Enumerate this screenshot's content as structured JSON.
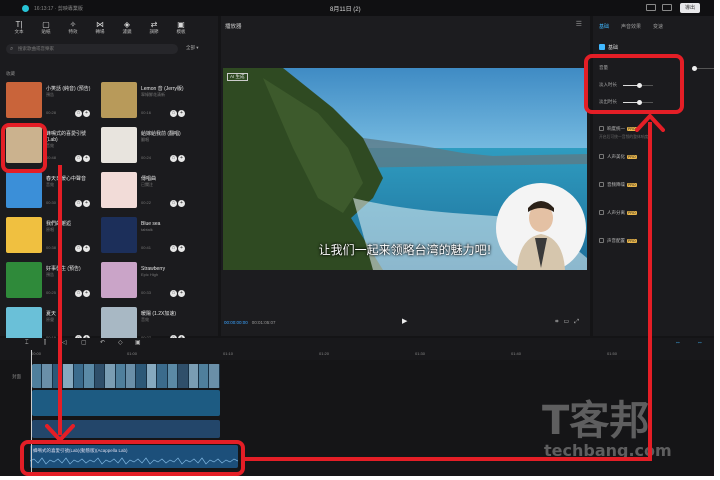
{
  "app": {
    "project_label": "16:13:17 · 剪映專業版",
    "date_title": "8月11日 (2)",
    "export_label": "導出"
  },
  "toolbar": {
    "items": [
      {
        "glyph": "T|",
        "label": "文本"
      },
      {
        "glyph": "▢",
        "label": "貼紙"
      },
      {
        "glyph": "✧",
        "label": "特效"
      },
      {
        "glyph": "⋈",
        "label": "轉場"
      },
      {
        "glyph": "◈",
        "label": "濾鏡"
      },
      {
        "glyph": "⇄",
        "label": "調節"
      },
      {
        "glyph": "▣",
        "label": "模板"
      }
    ]
  },
  "media": {
    "search_placeholder": "搜索歌曲或音樂家",
    "filter_label": "全部",
    "section_label": "收藏",
    "items": [
      {
        "title": "小笑話 (純音) (預告)",
        "artist": "預告",
        "duration": "00:28",
        "color": "#c9643a"
      },
      {
        "title": "Lemon 音 (Jerry版)",
        "artist": "翠綠鮮花清新",
        "duration": "00:16",
        "color": "#b89a5a"
      },
      {
        "title": "蜂鳴式的喜愛引號 (Lab)",
        "artist": "音效",
        "duration": "00:48",
        "color": "#cbb28e"
      },
      {
        "title": "給嫁給我前 (翻唱)",
        "artist": "翻唱",
        "duration": "00:24",
        "color": "#e8e4de"
      },
      {
        "title": "春天日暖心中聲音",
        "artist": "音效",
        "duration": "00:30",
        "color": "#3b8fd8"
      },
      {
        "title": "傳唱曲",
        "artist": "已關注",
        "duration": "00:22",
        "color": "#f2dcd8"
      },
      {
        "title": "我們的邂逅",
        "artist": "原唱",
        "duration": "00:38",
        "color": "#f0c040"
      },
      {
        "title": "Blue sea",
        "artist": "tabtalk",
        "duration": "00:41",
        "color": "#1c2f5a"
      },
      {
        "title": "好事發生 (預告)",
        "artist": "預告",
        "duration": "00:25",
        "color": "#2f8a3a"
      },
      {
        "title": "Strawberry",
        "artist": "Epic High",
        "duration": "00:33",
        "color": "#caa4c8"
      },
      {
        "title": "夏天",
        "artist": "原聲",
        "duration": "00:19",
        "color": "#6ac0d8"
      },
      {
        "title": "暖陽 (1.2X加速)",
        "artist": "音效",
        "duration": "00:27",
        "color": "#a8b8c4"
      }
    ]
  },
  "player": {
    "title": "播放器",
    "caption": "让我们一起来领略台湾的魅力吧!",
    "watermark": "AI 生成",
    "timecode_current": "00:00:00:00",
    "timecode_total": "00:01:05:07"
  },
  "properties": {
    "tabs": [
      "基础",
      "声音效果",
      "变速"
    ],
    "basic_label": "基础",
    "volume_label": "音量",
    "fade_in_label": "淡入时长",
    "fade_out_label": "淡出时长",
    "volume_level": 0.05,
    "fade_in_level": 0.55,
    "fade_out_level": 0.55,
    "options": [
      {
        "label": "响度统一",
        "sub": "开启后可统一音频的整体响度"
      },
      {
        "label": "人声美化",
        "sub": ""
      },
      {
        "label": "音频降噪",
        "sub": ""
      },
      {
        "label": "人声分离",
        "sub": ""
      },
      {
        "label": "声音配置",
        "sub": ""
      }
    ]
  },
  "timeline": {
    "ruler": [
      "00:00",
      "01:00",
      "01:10",
      "01:20",
      "01:30",
      "01:40",
      "01:50"
    ],
    "track_label": "封面",
    "audio_clip_label": "蜂鳴式的喜愛引號(Lab)(動態版)(Acappella Lab)"
  },
  "watermark_logo": {
    "brand_cn": "T客邦",
    "brand_en": "techbang.com"
  },
  "colors": {
    "annotation_red": "#e41e26",
    "accent_blue": "#40b8ff"
  }
}
